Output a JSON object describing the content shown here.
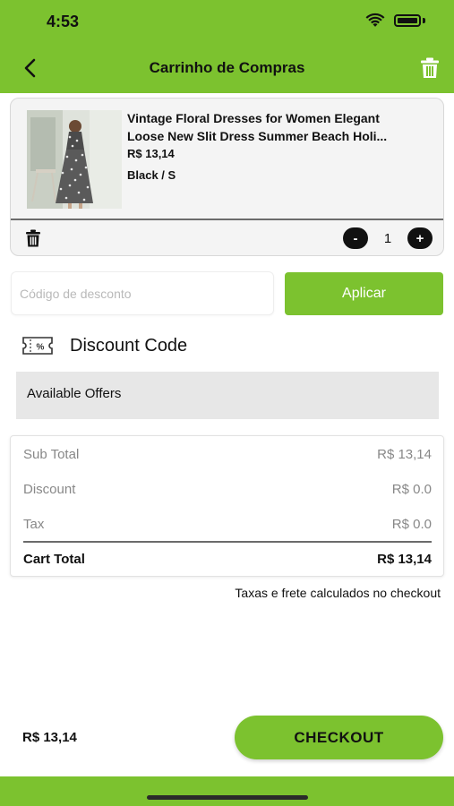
{
  "status_bar": {
    "time": "4:53",
    "wifi_icon": "wifi-icon",
    "battery_icon": "battery-icon"
  },
  "header": {
    "title": "Carrinho de Compras",
    "back_icon": "chevron-left-icon",
    "trash_icon": "trash-icon"
  },
  "cart_item": {
    "name_line1": "Vintage Floral Dresses for Women Elegant",
    "name_line2": "Loose New Slit Dress Summer Beach Holi...",
    "price": "R$ 13,14",
    "variant": "Black / S",
    "quantity": "1",
    "minus_label": "-",
    "plus_label": "+"
  },
  "discount": {
    "placeholder": "Código de desconto",
    "value": "",
    "apply_label": "Aplicar",
    "section_title": "Discount Code",
    "coupon_icon": "coupon-icon",
    "coupon_icon_text": "%"
  },
  "offers": {
    "label": "Available Offers"
  },
  "summary": {
    "subtotal_label": "Sub Total",
    "subtotal_value": "R$ 13,14",
    "discount_label": "Discount",
    "discount_value": "R$ 0.0",
    "tax_label": "Tax",
    "tax_value": "R$ 0.0",
    "total_label": "Cart Total",
    "total_value": "R$ 13,14"
  },
  "tax_note": "Taxas e frete calculados no checkout",
  "footer": {
    "price": "R$ 13,14",
    "checkout_label": "CHECKOUT"
  },
  "colors": {
    "brand_green": "#7cc22f",
    "text_dark": "#111111",
    "muted_gray": "#888888",
    "offers_bg": "#e7e7e7"
  }
}
